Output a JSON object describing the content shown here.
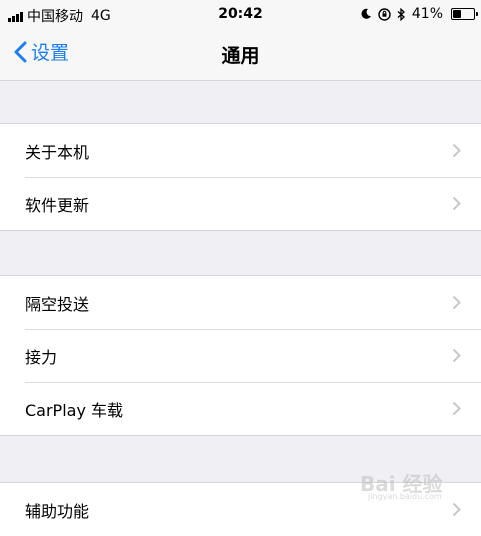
{
  "status_bar": {
    "carrier": "中国移动",
    "network": "4G",
    "time": "20:42",
    "battery_percent": "41%",
    "battery_level": 0.41
  },
  "nav": {
    "back_label": "设置",
    "title": "通用"
  },
  "groups": [
    {
      "items": [
        "关于本机",
        "软件更新"
      ]
    },
    {
      "items": [
        "隔空投送",
        "接力",
        "CarPlay 车载"
      ]
    },
    {
      "items": [
        "辅助功能"
      ]
    }
  ],
  "watermark": {
    "text": "Bai 经验",
    "sub": "jingyan.baidu.com"
  },
  "colors": {
    "accent": "#1a7df5",
    "background": "#efeff4",
    "chevron": "#c7c7cc"
  }
}
